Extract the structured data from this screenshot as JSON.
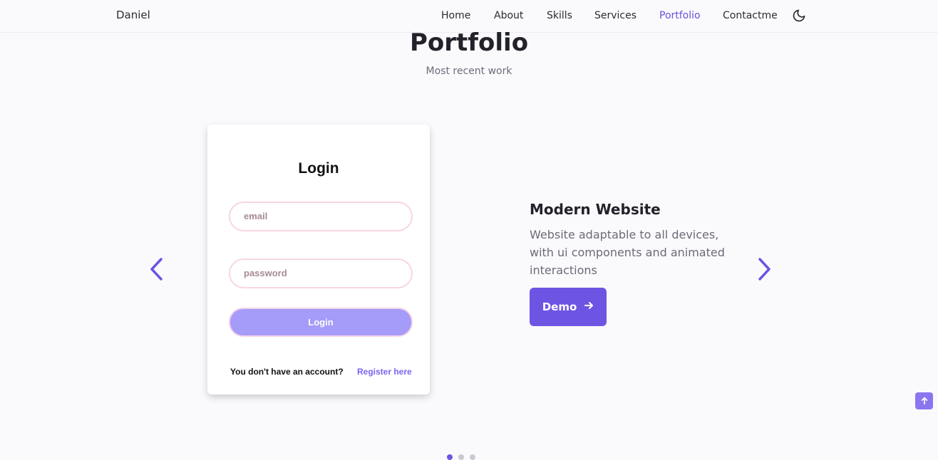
{
  "header": {
    "logo": "Daniel",
    "nav": [
      "Home",
      "About",
      "Skills",
      "Services",
      "Portfolio",
      "Contactme"
    ],
    "active_nav": "Portfolio",
    "theme_icon": "moon-icon"
  },
  "section": {
    "title": "Portfolio",
    "subtitle": "Most recent work"
  },
  "project": {
    "preview": {
      "heading": "Login",
      "email_placeholder": "email",
      "password_placeholder": "password",
      "login_button": "Login",
      "account_text": "You don't have an account?",
      "register_link": "Register here"
    },
    "title": "Modern Website",
    "description": "Website adaptable to all devices, with ui components and animated interactions",
    "demo_label": "Demo"
  },
  "carousel": {
    "prev_icon": "chevron-left-icon",
    "next_icon": "chevron-right-icon",
    "slides_count": 3,
    "active_slide": 1
  },
  "scroll_up_icon": "arrow-up-icon",
  "colors": {
    "accent": "#6e54e3",
    "accent_light": "#a59bf8",
    "text": "#22222a",
    "muted": "#6b6b78",
    "background": "#fafafd"
  }
}
